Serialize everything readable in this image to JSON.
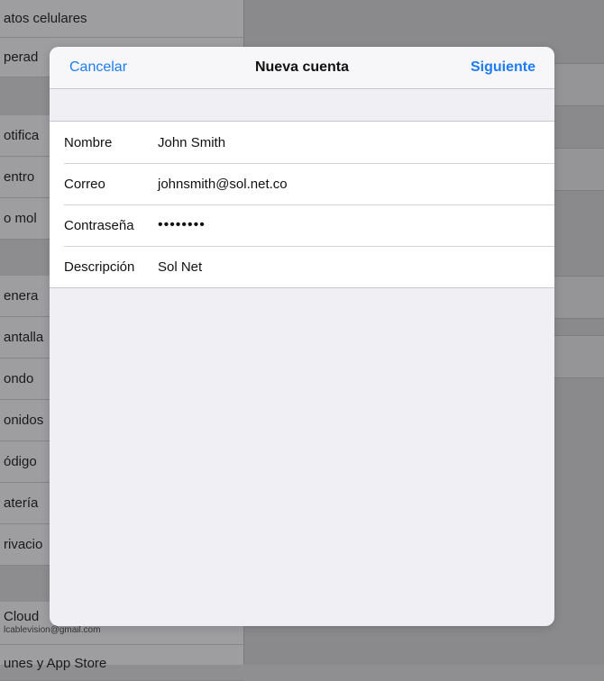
{
  "background_list": {
    "rows": [
      {
        "label": "atos celulares"
      },
      {
        "label": "perad"
      },
      {
        "label": "otifica"
      },
      {
        "label": "entro"
      },
      {
        "label": "o mol"
      },
      {
        "label": "enera"
      },
      {
        "label": "antalla"
      },
      {
        "label": "ondo"
      },
      {
        "label": "onidos"
      },
      {
        "label": "ódigo"
      },
      {
        "label": "atería"
      },
      {
        "label": "rivacio"
      },
      {
        "label": "Cloud",
        "sub": "lcablevision@gmail.com"
      },
      {
        "label": "unes y App Store"
      }
    ]
  },
  "modal": {
    "cancel_label": "Cancelar",
    "title": "Nueva cuenta",
    "next_label": "Siguiente",
    "fields": [
      {
        "label": "Nombre",
        "value": "John Smith"
      },
      {
        "label": "Correo",
        "value": "johnsmith@sol.net.co"
      },
      {
        "label": "Contraseña",
        "value": "••••••••"
      },
      {
        "label": "Descripción",
        "value": "Sol Net"
      }
    ]
  },
  "colors": {
    "accent": "#1e7cf2",
    "modal_bg": "#efeff4"
  }
}
